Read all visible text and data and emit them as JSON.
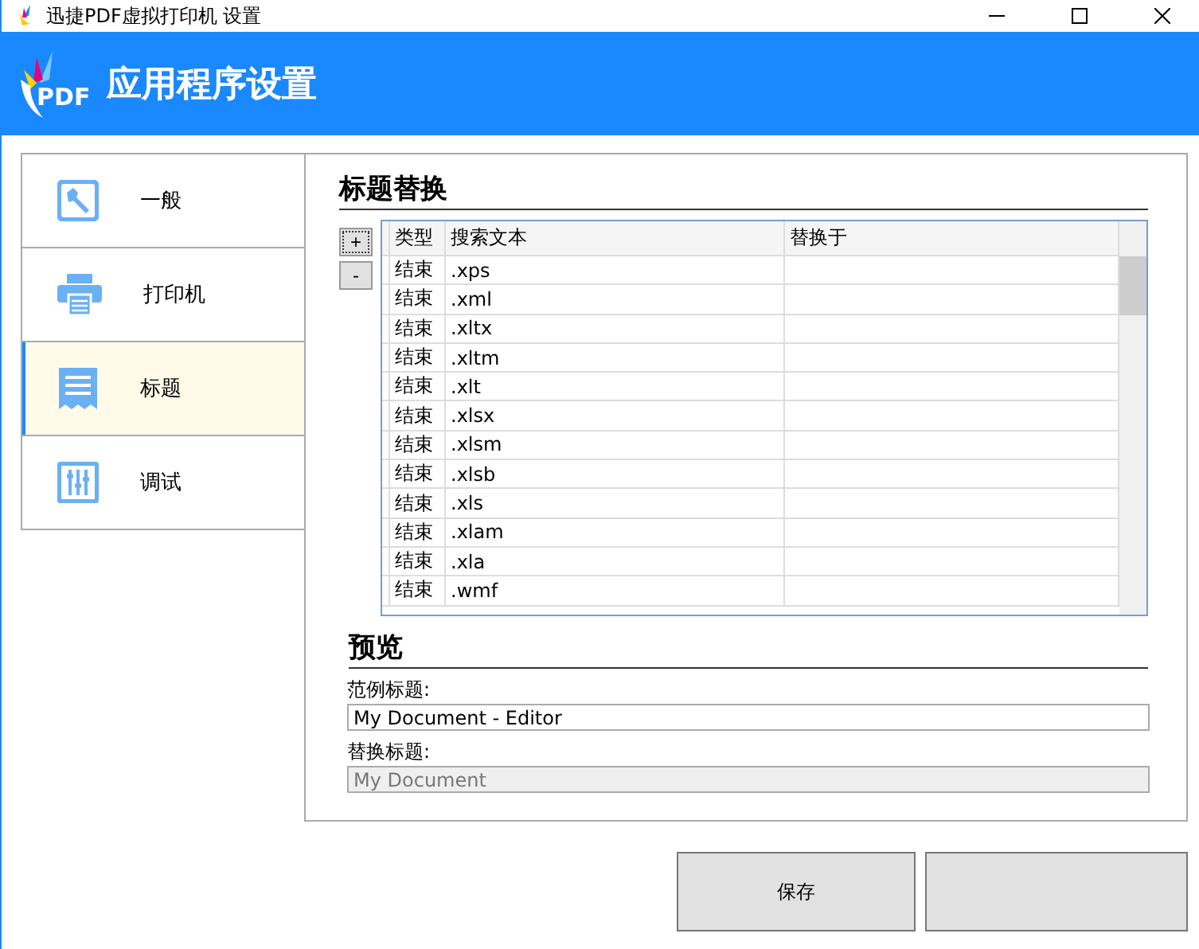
{
  "window": {
    "title": "迅捷PDF虚拟打印机 设置"
  },
  "header": {
    "logo_text": "PDF",
    "title": "应用程序设置"
  },
  "sidebar": {
    "items": [
      {
        "kind": "wrench",
        "label": "一般",
        "selected": false
      },
      {
        "kind": "printer",
        "label": "打印机",
        "selected": false
      },
      {
        "kind": "title",
        "label": "标题",
        "selected": true
      },
      {
        "kind": "sliders",
        "label": "调试",
        "selected": false
      }
    ]
  },
  "section": {
    "title": "标题替换",
    "add_button": "+",
    "remove_button": "-"
  },
  "table": {
    "columns": [
      "类型",
      "搜索文本",
      "替换于"
    ],
    "rows": [
      [
        "结束",
        ".xps",
        ""
      ],
      [
        "结束",
        ".xml",
        ""
      ],
      [
        "结束",
        ".xltx",
        ""
      ],
      [
        "结束",
        ".xltm",
        ""
      ],
      [
        "结束",
        ".xlt",
        ""
      ],
      [
        "结束",
        ".xlsx",
        ""
      ],
      [
        "结束",
        ".xlsm",
        ""
      ],
      [
        "结束",
        ".xlsb",
        ""
      ],
      [
        "结束",
        ".xls",
        ""
      ],
      [
        "结束",
        ".xlam",
        ""
      ],
      [
        "结束",
        ".xla",
        ""
      ],
      [
        "结束",
        ".wmf",
        ""
      ]
    ]
  },
  "preview": {
    "title": "预览",
    "fields": [
      {
        "label": "范例标题:",
        "value": "My Document - Editor",
        "disabled": false
      },
      {
        "label": "替换标题:",
        "value": "My Document",
        "disabled": true
      }
    ]
  },
  "buttons": [
    {
      "label": "保存"
    }
  ]
}
